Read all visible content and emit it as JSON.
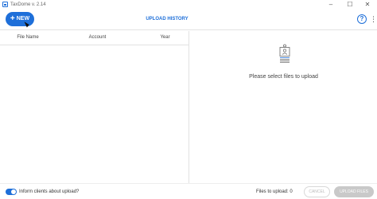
{
  "window": {
    "title": "TaxDome v. 2.14",
    "minimize_glyph": "–",
    "maximize_glyph": "☐",
    "close_glyph": "✕"
  },
  "toolbar": {
    "new_plus": "+",
    "new_label": "NEW",
    "upload_history_label": "UPLOAD HISTORY",
    "help_glyph": "?",
    "more_glyph": "⋮"
  },
  "table": {
    "columns": [
      "File Name",
      "Account",
      "Year"
    ],
    "rows": []
  },
  "empty_state": {
    "icon": "document-stack-icon",
    "message": "Please select files to upload"
  },
  "footer": {
    "inform_clients_label": "Inform clients about upload?",
    "inform_clients_enabled": true,
    "files_to_upload": "Files to upload: 0",
    "cancel_label": "CANCEL",
    "upload_label": "UPLOAD FILES"
  },
  "colors": {
    "accent": "#1e6fd9",
    "disabled": "#c9c9c9",
    "border": "#e2e2e2"
  }
}
